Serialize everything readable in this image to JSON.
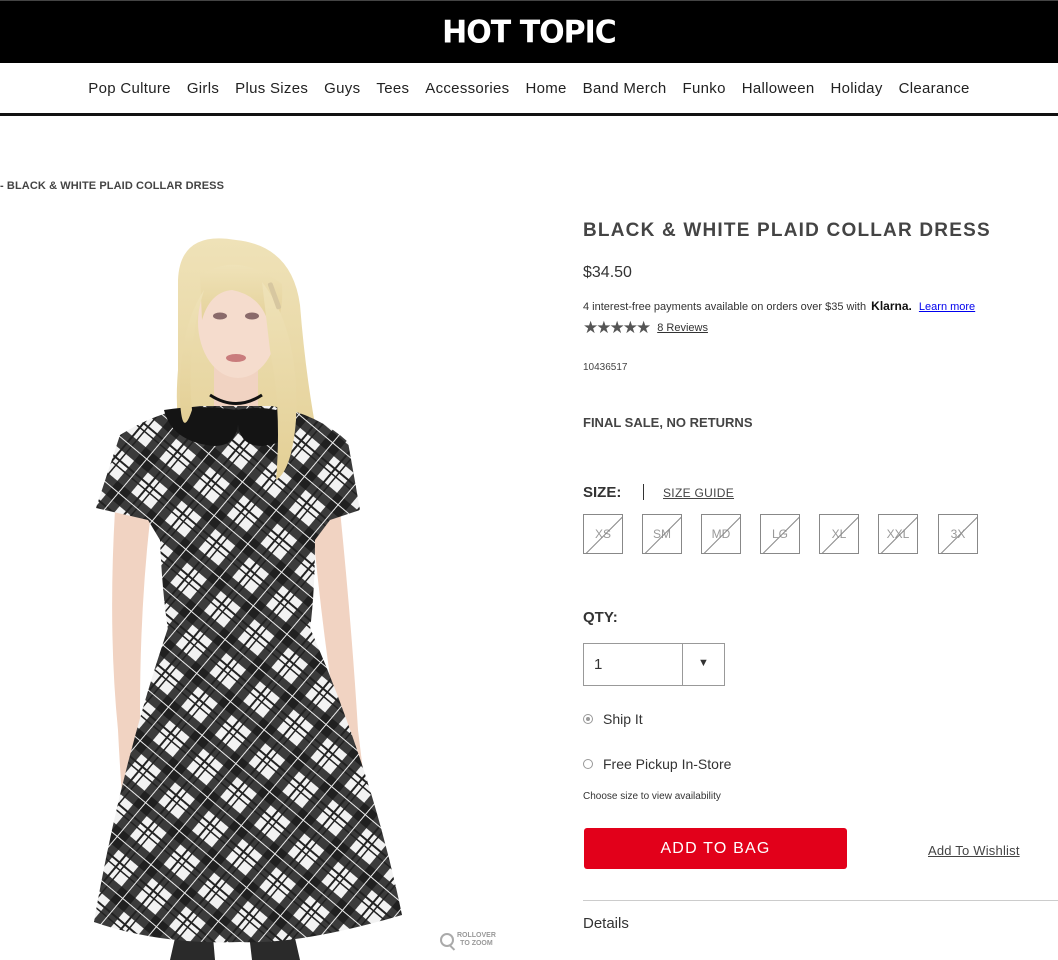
{
  "header": {
    "logo": "HOT TOPIC",
    "nav": [
      "Pop Culture",
      "Girls",
      "Plus Sizes",
      "Guys",
      "Tees",
      "Accessories",
      "Home",
      "Band Merch",
      "Funko",
      "Halloween",
      "Holiday",
      "Clearance"
    ]
  },
  "breadcrumb": "- BLACK & WHITE PLAID COLLAR DRESS",
  "product": {
    "title": "BLACK & WHITE PLAID COLLAR DRESS",
    "price": "$34.50",
    "klarna_text": "4 interest-free payments available on orders over $35 with",
    "klarna_logo": "Klarna.",
    "klarna_link": "Learn more",
    "stars": "★★★★★",
    "reviews": "8 Reviews",
    "sku": "10436517",
    "final_sale": "FINAL SALE, NO RETURNS",
    "zoom_hint_line1": "ROLLOVER",
    "zoom_hint_line2": "TO ZOOM"
  },
  "size": {
    "label": "SIZE:",
    "guide": "SIZE GUIDE",
    "options": [
      "XS",
      "SM",
      "MD",
      "LG",
      "XL",
      "XXL",
      "3X"
    ]
  },
  "qty": {
    "label": "QTY:",
    "value": "1"
  },
  "fulfillment": {
    "ship_label": "Ship It",
    "pickup_label": "Free Pickup In-Store",
    "availability_note": "Choose size to view availability"
  },
  "actions": {
    "add_to_bag": "ADD TO BAG",
    "wishlist": "Add To Wishlist"
  },
  "details_heading": "Details",
  "colors": {
    "brand_black": "#000000",
    "add_to_bag_red": "#e2001a"
  }
}
